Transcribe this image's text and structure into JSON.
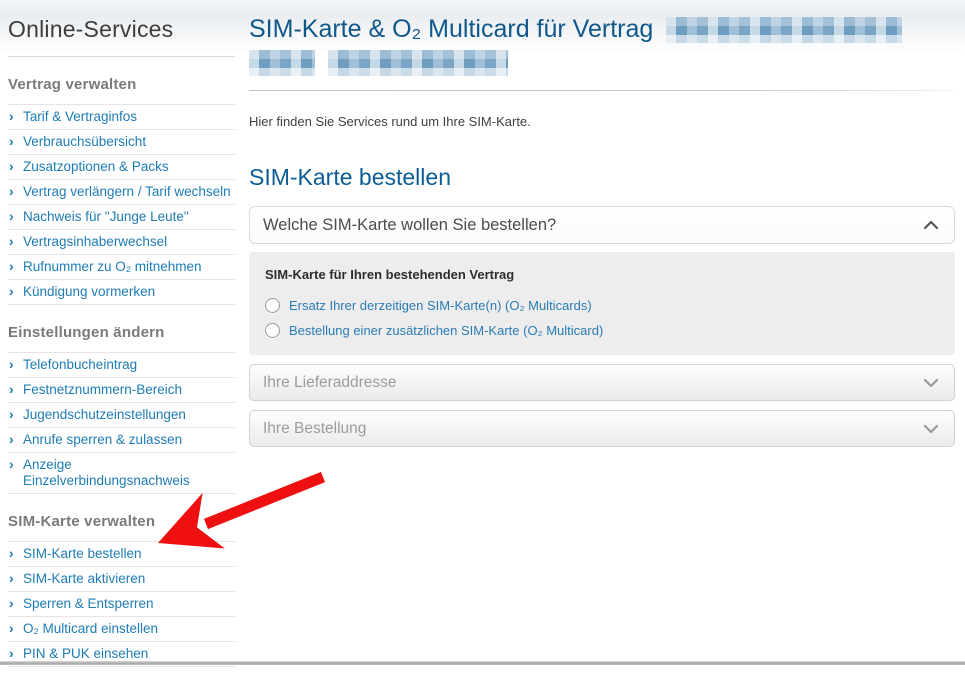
{
  "colors": {
    "heading_blue": "#10578a",
    "link_blue": "#1e7cb5",
    "arrow_red": "#ee1010"
  },
  "sidebar": {
    "title": "Online-Services",
    "sections": [
      {
        "heading": "Vertrag verwalten",
        "items": [
          "Tarif & Vertraginfos",
          "Verbrauchsübersicht",
          "Zusatzoptionen & Packs",
          "Vertrag verlängern / Tarif wechseln",
          "Nachweis für \"Junge Leute\"",
          "Vertragsinhaberwechsel",
          "Rufnummer zu O₂ mitnehmen",
          "Kündigung vormerken"
        ]
      },
      {
        "heading": "Einstellungen ändern",
        "items": [
          "Telefonbucheintrag",
          "Festnetznummern-Bereich",
          "Jugendschutzeinstellungen",
          "Anrufe sperren & zulassen",
          "Anzeige Einzelverbindungsnachweis"
        ]
      },
      {
        "heading": "SIM-Karte verwalten",
        "items": [
          "SIM-Karte bestellen",
          "SIM-Karte aktivieren",
          "Sperren & Entsperren",
          "O₂ Multicard einstellen",
          "PIN & PUK einsehen"
        ]
      }
    ]
  },
  "main": {
    "heading_prefix": "SIM-Karte & O₂ Multicard für Vertrag",
    "intro": "Hier finden Sie Services rund um Ihre SIM-Karte.",
    "section_title": "SIM-Karte bestellen",
    "order_accordion": {
      "question": "Welche SIM-Karte wollen Sie bestellen?",
      "panel_title": "SIM-Karte für Ihren bestehenden Vertrag",
      "options": [
        "Ersatz Ihrer derzeitigen SIM-Karte(n) (O₂ Multicards)",
        "Bestellung einer zusätzlichen SIM-Karte (O₂ Multicard)"
      ]
    },
    "collapsed_accordions": [
      "Ihre Lieferaddresse",
      "Ihre Bestellung"
    ]
  }
}
